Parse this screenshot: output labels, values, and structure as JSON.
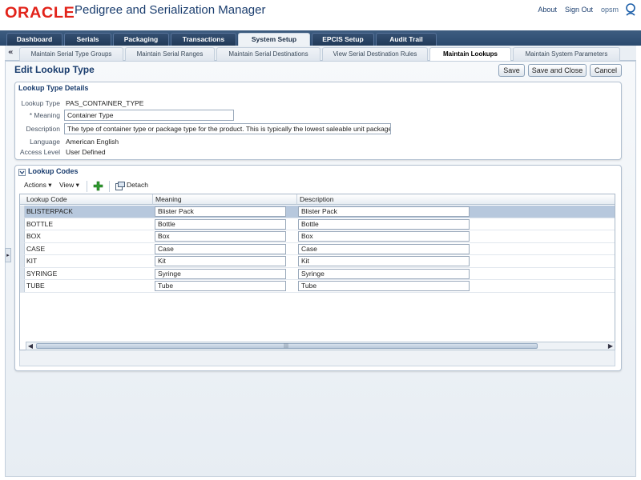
{
  "header": {
    "logo": "ORACLE",
    "app_title": "Pedigree and Serialization Manager",
    "links": {
      "about": "About",
      "sign_out": "Sign Out",
      "user": "opsm"
    }
  },
  "main_tabs": [
    {
      "label": "Dashboard",
      "active": false
    },
    {
      "label": "Serials",
      "active": false
    },
    {
      "label": "Packaging",
      "active": false
    },
    {
      "label": "Transactions",
      "active": false
    },
    {
      "label": "System Setup",
      "active": true
    },
    {
      "label": "EPCIS Setup",
      "active": false
    },
    {
      "label": "Audit Trail",
      "active": false
    }
  ],
  "sub_tabs": [
    {
      "label": "Maintain Serial Type Groups"
    },
    {
      "label": "Maintain Serial Ranges"
    },
    {
      "label": "Maintain Serial Destinations"
    },
    {
      "label": "View Serial Destination Rules"
    },
    {
      "label": "Maintain Lookups",
      "active": true
    },
    {
      "label": "Maintain System Parameters"
    }
  ],
  "sub_tabs_scroll": "«",
  "page": {
    "title": "Edit Lookup Type",
    "buttons": {
      "save": "Save",
      "save_close": "Save and Close",
      "cancel": "Cancel"
    }
  },
  "details": {
    "title": "Lookup Type Details",
    "lookup_type_label": "Lookup Type",
    "lookup_type_value": "PAS_CONTAINER_TYPE",
    "meaning_label": "* Meaning",
    "meaning_value": "Container Type",
    "description_label": "Description",
    "description_value": "The type of container type or package type for the product.  This is typically the lowest saleable unit package.",
    "language_label": "Language",
    "language_value": "American English",
    "access_label": "Access Level",
    "access_value": "User Defined"
  },
  "codes": {
    "title": "Lookup Codes",
    "toolbar": {
      "actions": "Actions",
      "view": "View",
      "detach": "Detach"
    },
    "columns": {
      "code": "Lookup Code",
      "meaning": "Meaning",
      "description": "Description"
    },
    "rows": [
      {
        "code": "BLISTERPACK",
        "meaning": "Blister Pack",
        "description": "Blister Pack",
        "selected": true
      },
      {
        "code": "BOTTLE",
        "meaning": "Bottle",
        "description": "Bottle"
      },
      {
        "code": "BOX",
        "meaning": "Box",
        "description": "Box"
      },
      {
        "code": "CASE",
        "meaning": "Case",
        "description": "Case"
      },
      {
        "code": "KIT",
        "meaning": "Kit",
        "description": "Kit"
      },
      {
        "code": "SYRINGE",
        "meaning": "Syringe",
        "description": "Syringe"
      },
      {
        "code": "TUBE",
        "meaning": "Tube",
        "description": "Tube"
      }
    ]
  },
  "colors": {
    "brand": "#e2231a",
    "title": "#1a3d6e",
    "tab_bar": "#2b4a6e",
    "selected_row": "#b7c8dd",
    "add_icon": "#2e9b2e"
  },
  "icons": [
    "user-icon",
    "collapse-icon",
    "add-icon",
    "detach-icon",
    "expand-handle-icon",
    "scroll-left-icon",
    "scroll-right-icon"
  ]
}
